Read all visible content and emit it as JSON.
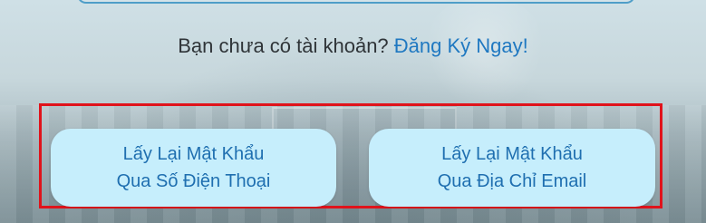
{
  "signup": {
    "prompt": "Bạn chưa có tài khoản?",
    "link_label": "Đăng Ký Ngay!"
  },
  "recovery": {
    "phone_button": {
      "line1": "Lấy Lại Mật Khẩu",
      "line2": "Qua Số Điện Thoại"
    },
    "email_button": {
      "line1": "Lấy Lại Mật Khẩu",
      "line2": "Qua Địa Chỉ Email"
    }
  },
  "colors": {
    "link": "#1f78c1",
    "button_bg": "#c6eefc",
    "button_text": "#1f6fb0",
    "highlight_border": "#e0131b"
  }
}
